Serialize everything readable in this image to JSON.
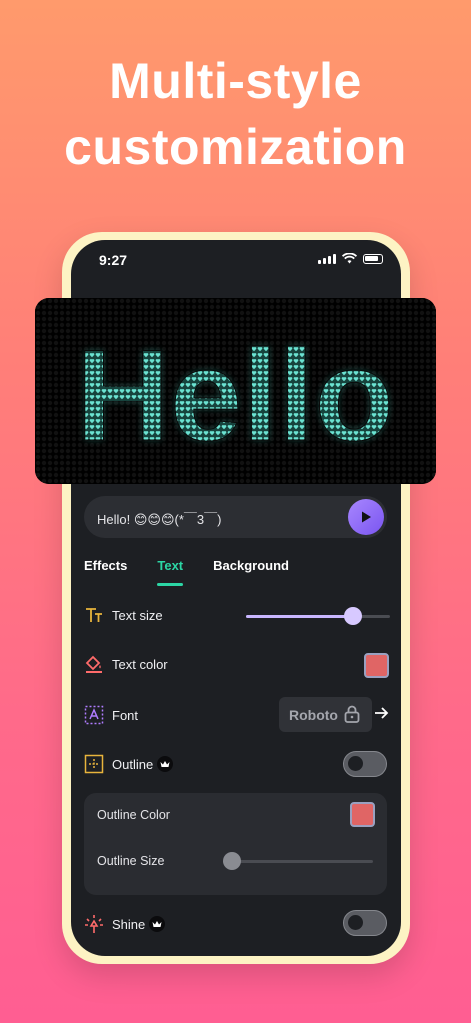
{
  "headline": {
    "line1": "Multi-style",
    "line2": "customization"
  },
  "status": {
    "time": "9:27"
  },
  "banner": {
    "text": "Hello",
    "led_color": "#6be3d2"
  },
  "message": {
    "text": "Hello! 😊😊😊(*￣3￣)"
  },
  "tabs": [
    {
      "label": "Effects",
      "active": false
    },
    {
      "label": "Text",
      "active": true
    },
    {
      "label": "Background",
      "active": false
    }
  ],
  "settings": {
    "text_size": {
      "label": "Text size",
      "value_percent": 74
    },
    "text_color": {
      "label": "Text color",
      "color": "#e06565"
    },
    "font": {
      "label": "Font",
      "value": "Roboto",
      "locked": true
    },
    "outline": {
      "label": "Outline",
      "premium": true,
      "enabled": false
    },
    "outline_color": {
      "label": "Outline Color",
      "color": "#e06565"
    },
    "outline_size": {
      "label": "Outline Size",
      "value_percent": 0
    },
    "shine": {
      "label": "Shine",
      "premium": true,
      "enabled": false
    }
  },
  "colors": {
    "accent": "#2cd6a5",
    "slider": "#c8b6ff",
    "play": "#8a64f5"
  },
  "icons": [
    "text-size-icon",
    "paint-bucket-icon",
    "font-icon",
    "outline-icon",
    "crown-icon",
    "lock-icon",
    "arrow-right-icon",
    "shine-icon",
    "play-icon",
    "wifi-icon",
    "battery-icon",
    "signal-icon"
  ]
}
